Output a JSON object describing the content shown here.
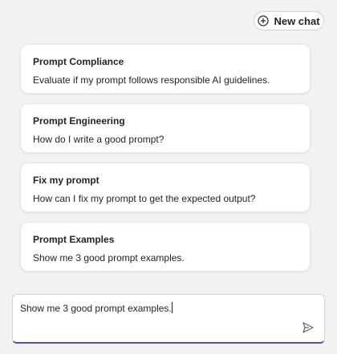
{
  "header": {
    "new_chat_label": "New chat",
    "new_chat_icon": "plus-circle-icon"
  },
  "prompts": [
    {
      "title": "Prompt Compliance",
      "description": "Evaluate if my prompt follows responsible AI guidelines."
    },
    {
      "title": "Prompt Engineering",
      "description": "How do I write a good prompt?"
    },
    {
      "title": "Fix my prompt",
      "description": "How can I fix my prompt to get the expected output?"
    },
    {
      "title": "Prompt Examples",
      "description": "Show me 3 good prompt examples."
    }
  ],
  "composer": {
    "value": "Show me 3 good prompt examples.",
    "send_icon": "send-icon"
  },
  "colors": {
    "background": "#f3f2f1",
    "accent": "#4f52b2",
    "card": "#ffffff"
  }
}
